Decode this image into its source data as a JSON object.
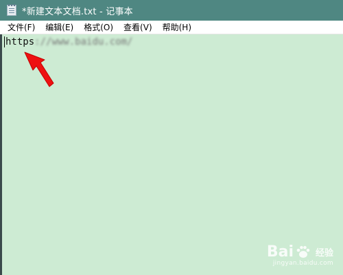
{
  "window": {
    "title": "*新建文本文档.txt - 记事本",
    "icon": "notepad-icon"
  },
  "menu": {
    "items": [
      {
        "label": "文件(F)"
      },
      {
        "label": "编辑(E)"
      },
      {
        "label": "格式(O)"
      },
      {
        "label": "查看(V)"
      },
      {
        "label": "帮助(H)"
      }
    ]
  },
  "editor": {
    "visible_text": "https",
    "blurred_text": "://www.baidu.com/",
    "background_color": "#cdebd3"
  },
  "annotation": {
    "type": "red-arrow",
    "color": "#ee1111",
    "points_to": "start of text"
  },
  "watermark": {
    "brand": "Bai",
    "brand_suffix": "经验",
    "url": "jingyan.baidu.com"
  }
}
